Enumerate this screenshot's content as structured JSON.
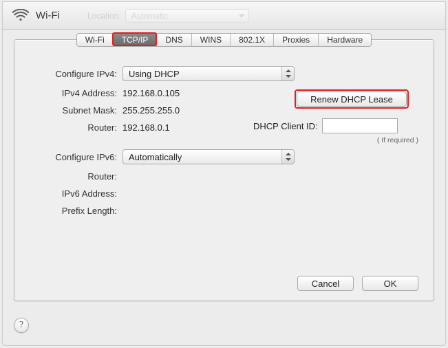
{
  "title": "Wi-Fi",
  "ghost": {
    "location_label": "Location:",
    "location_value": "Automatic"
  },
  "tabs": [
    "Wi-Fi",
    "TCP/IP",
    "DNS",
    "WINS",
    "802.1X",
    "Proxies",
    "Hardware"
  ],
  "active_tab_index": 1,
  "ipv4": {
    "configure_label": "Configure IPv4:",
    "configure_value": "Using DHCP",
    "address_label": "IPv4 Address:",
    "address_value": "192.168.0.105",
    "subnet_label": "Subnet Mask:",
    "subnet_value": "255.255.255.0",
    "router_label": "Router:",
    "router_value": "192.168.0.1"
  },
  "ipv6": {
    "configure_label": "Configure IPv6:",
    "configure_value": "Automatically",
    "router_label": "Router:",
    "router_value": "",
    "address_label": "IPv6 Address:",
    "address_value": "",
    "prefix_label": "Prefix Length:",
    "prefix_value": ""
  },
  "dhcp": {
    "renew_button": "Renew DHCP Lease",
    "client_id_label": "DHCP Client ID:",
    "client_id_value": "",
    "hint": "( If required )"
  },
  "footer": {
    "cancel": "Cancel",
    "ok": "OK"
  },
  "help_glyph": "?"
}
